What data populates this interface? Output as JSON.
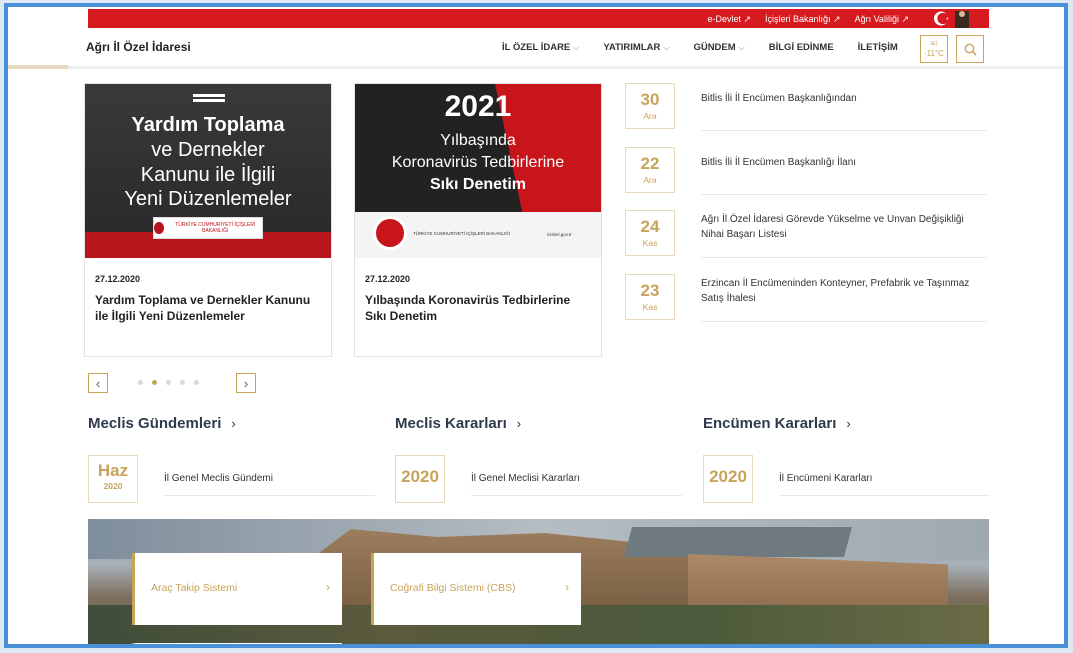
{
  "topbar": {
    "links": [
      "e-Devlet ↗",
      "İçişleri Bakanlığı ↗",
      "Ağrı Valiliği ↗"
    ]
  },
  "header": {
    "brand": "Ağrı İl Özel İdaresi",
    "nav": [
      {
        "label": "İL ÖZEL İDARE",
        "chevron": true
      },
      {
        "label": "YATIRIMLAR",
        "chevron": true
      },
      {
        "label": "GÜNDEM",
        "chevron": true
      },
      {
        "label": "BİLGİ EDİNME",
        "chevron": false
      },
      {
        "label": "İLETİŞİM",
        "chevron": false
      }
    ],
    "weather": "-11°C"
  },
  "cards": [
    {
      "date": "27.12.2020",
      "title": "Yardım Toplama ve Dernekler Kanunu ile İlgili Yeni Düzenlemeler",
      "image_lines": [
        "Yardım Toplama",
        "ve Dernekler",
        "Kanunu ile İlgili",
        "Yeni Düzenlemeler"
      ],
      "image_badge": "TÜRKİYE CUMHURİYETİ İÇİŞLERİ BAKANLIĞI"
    },
    {
      "date": "27.12.2020",
      "title": "Yılbaşında Koronavirüs Tedbirlerine Sıkı Denetim",
      "image_year": "2021",
      "image_lines": [
        "Yılbaşında",
        "Koronavirüs Tedbirlerine",
        "Sıkı Denetim"
      ],
      "image_badge": "TÜRKİYE CUMHURİYETİ İÇİŞLERİ BAKANLIĞI",
      "image_url": "icisleri.gov.tr"
    }
  ],
  "side_news": [
    {
      "day": "30",
      "month": "Ara",
      "title": "Bitlis İli İl Encümen Başkanlığından"
    },
    {
      "day": "22",
      "month": "Ara",
      "title": "Bitlis İli İl Encümen Başkanlığı İlanı"
    },
    {
      "day": "24",
      "month": "Kas",
      "title": "Ağrı İl Özel İdaresi Görevde Yükselme ve Unvan Değişikliği Nihai Başarı Listesi"
    },
    {
      "day": "23",
      "month": "Kas",
      "title": "Erzincan İl Encümeninden Konteyner, Prefabrik ve Taşınmaz Satış İhalesi"
    }
  ],
  "slider": {
    "prev": "‹",
    "next": "›",
    "dot_count": 5,
    "active_dot": 1
  },
  "sections": [
    {
      "title": "Meclis Gündemleri",
      "badge_big": "Haz",
      "badge_small": "2020",
      "item": "İl Genel Meclis Gündemi"
    },
    {
      "title": "Meclis Kararları",
      "badge_big": "2020",
      "badge_small": "",
      "item": "İl Genel Meclisi Kararları"
    },
    {
      "title": "Encümen Kararları",
      "badge_big": "2020",
      "badge_small": "",
      "item": "İl Encümeni Kararları"
    }
  ],
  "quick_links": [
    {
      "label": "Araç Takip Sistemi"
    },
    {
      "label": "Coğrafi Bilgi Sistemi (CBS)"
    }
  ],
  "colors": {
    "accent": "#c8a35a",
    "brand_red": "#d71920",
    "frame": "#4a90d9"
  }
}
